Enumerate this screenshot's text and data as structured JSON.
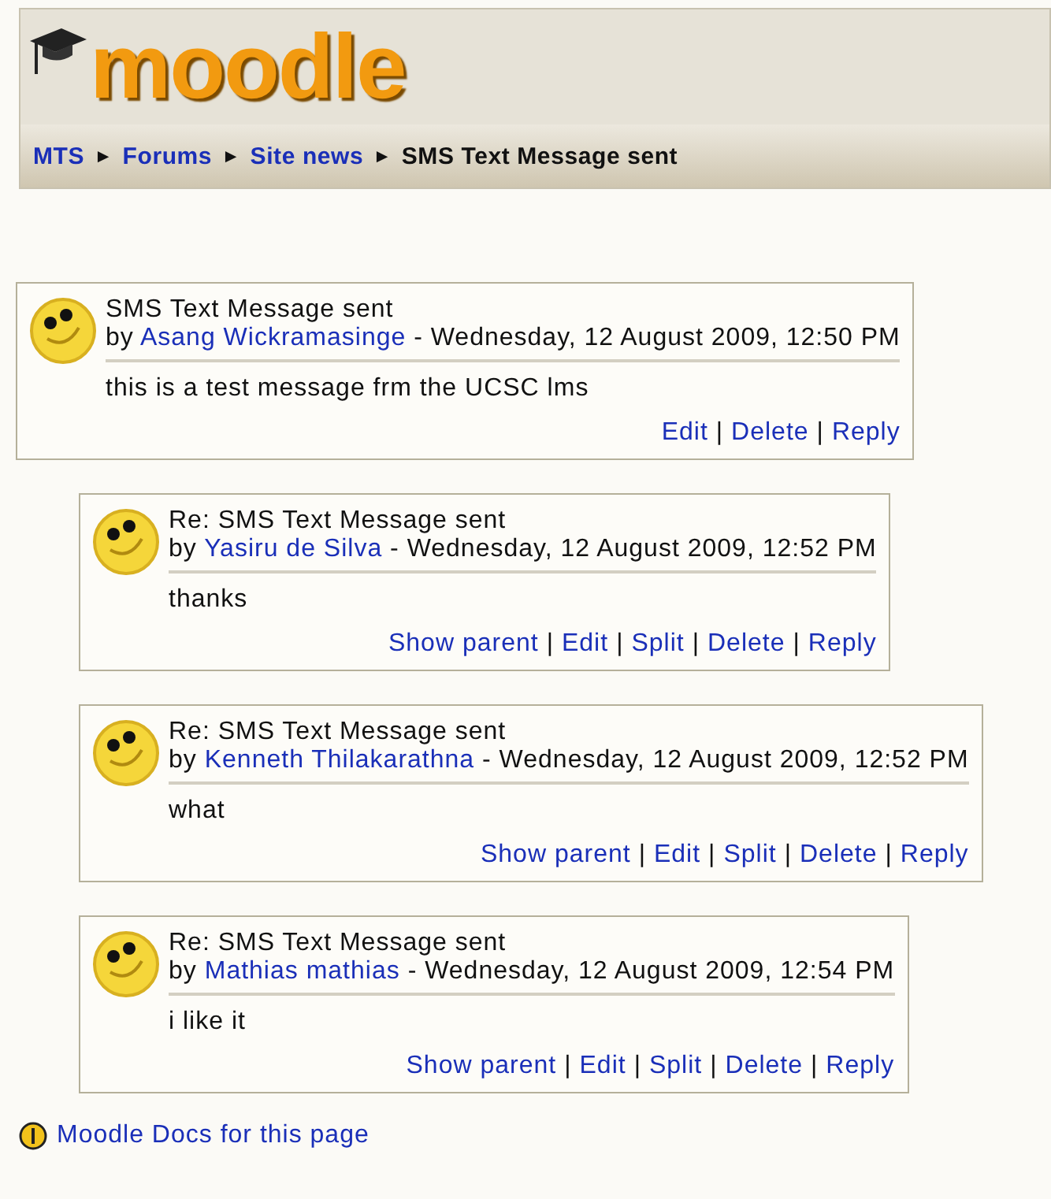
{
  "header": {
    "logo": "moodle",
    "breadcrumb": [
      {
        "label": "MTS",
        "kind": "link"
      },
      {
        "label": "Forums",
        "kind": "link"
      },
      {
        "label": "Site news",
        "kind": "link"
      },
      {
        "label": "SMS Text Message sent",
        "kind": "current"
      }
    ],
    "separator": "►"
  },
  "posts": [
    {
      "subject": "SMS Text Message sent",
      "by": "by",
      "author": "Asang Wickramasinge",
      "date": "- Wednesday, 12 August 2009, 12:50 PM",
      "message": "this is a test message frm the UCSC lms",
      "commands": [
        "Edit",
        "Delete",
        "Reply"
      ],
      "children": [
        {
          "subject": "Re: SMS Text Message sent",
          "by": "by",
          "author": "Yasiru de Silva",
          "date": "- Wednesday, 12 August 2009, 12:52 PM",
          "message": "thanks",
          "commands": [
            "Show parent",
            "Edit",
            "Split",
            "Delete",
            "Reply"
          ]
        },
        {
          "subject": "Re: SMS Text Message sent",
          "by": "by",
          "author": "Kenneth Thilakarathna",
          "date": "- Wednesday, 12 August 2009, 12:52 PM",
          "message": "what",
          "commands": [
            "Show parent",
            "Edit",
            "Split",
            "Delete",
            "Reply"
          ]
        },
        {
          "subject": "Re: SMS Text Message sent",
          "by": "by",
          "author": "Mathias mathias",
          "date": "- Wednesday, 12 August 2009, 12:54 PM",
          "message": "i like it",
          "commands": [
            "Show parent",
            "Edit",
            "Split",
            "Delete",
            "Reply"
          ]
        }
      ]
    }
  ],
  "command_separator": "|",
  "footer": {
    "docs_link": "Moodle Docs for this page"
  }
}
